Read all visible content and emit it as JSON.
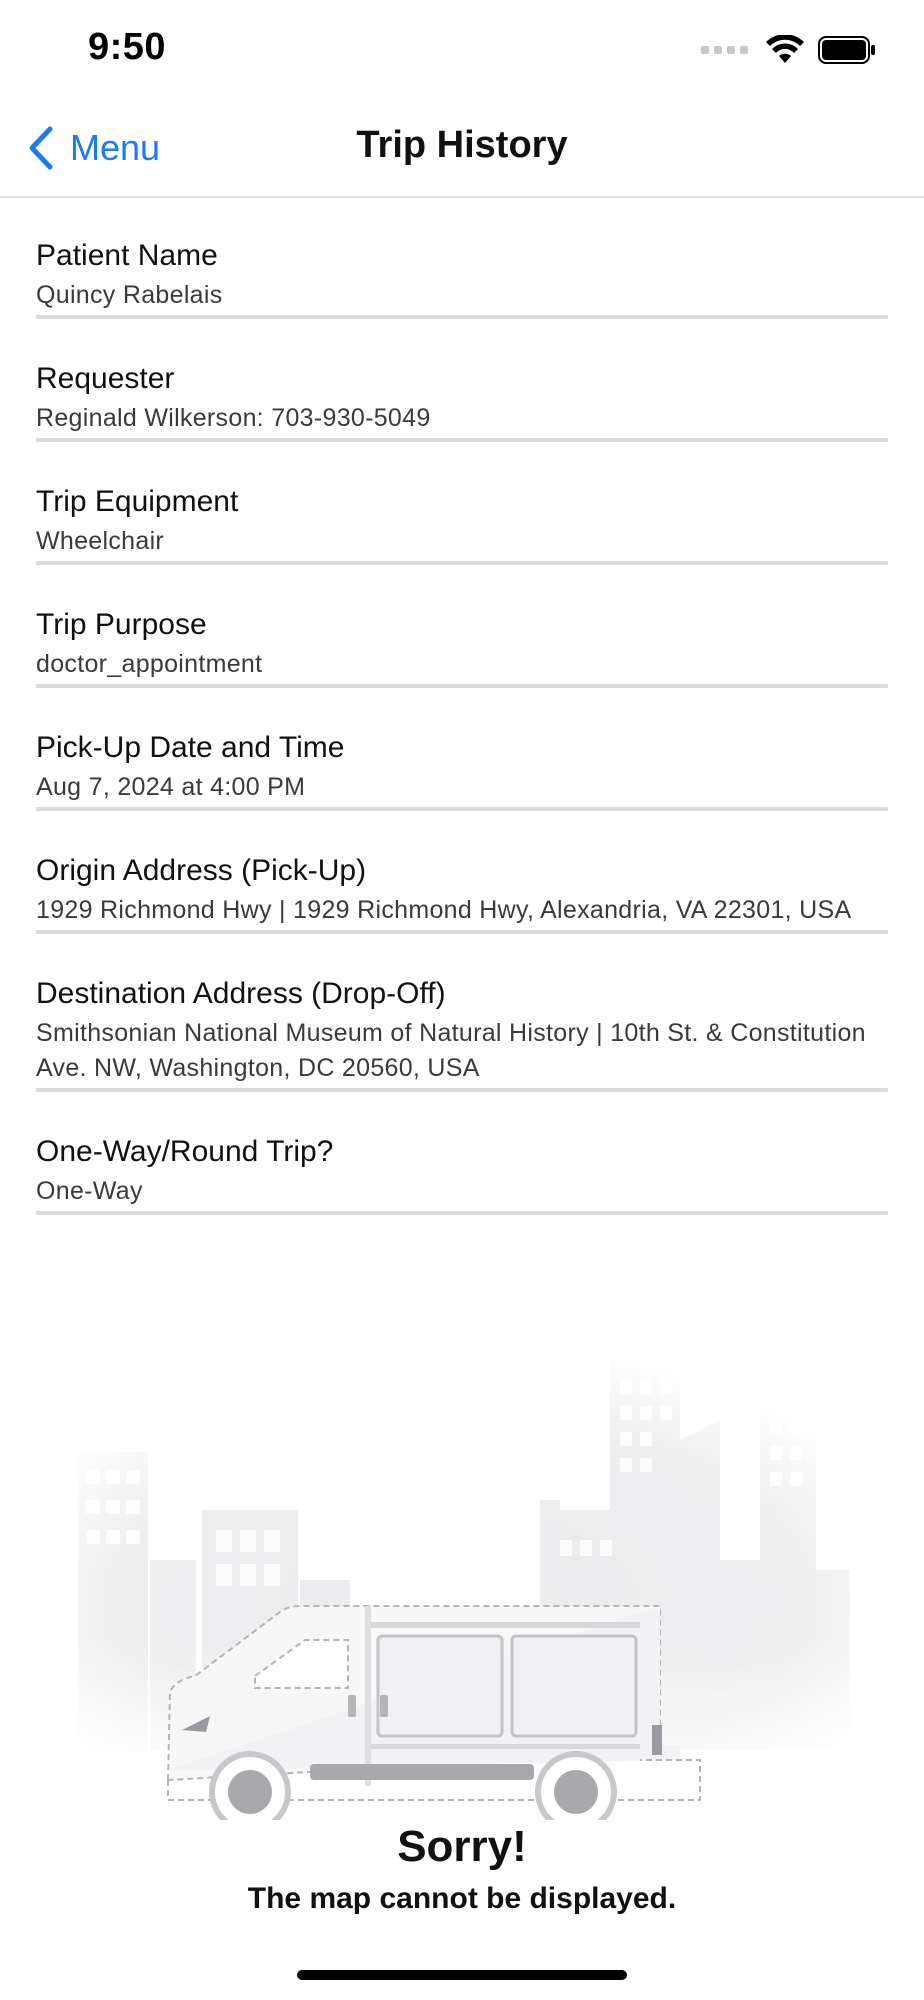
{
  "status_bar": {
    "time": "9:50"
  },
  "nav": {
    "back_label": "Menu",
    "title": "Trip History"
  },
  "fields": [
    {
      "label": "Patient Name",
      "value": "Quincy Rabelais"
    },
    {
      "label": "Requester",
      "value": "Reginald Wilkerson: 703-930-5049"
    },
    {
      "label": "Trip Equipment",
      "value": "Wheelchair"
    },
    {
      "label": "Trip Purpose",
      "value": "doctor_appointment"
    },
    {
      "label": "Pick-Up Date and Time",
      "value": "Aug 7, 2024 at 4:00 PM"
    },
    {
      "label": "Origin Address (Pick-Up)",
      "value": "1929 Richmond Hwy | 1929 Richmond Hwy, Alexandria, VA 22301, USA"
    },
    {
      "label": "Destination Address (Drop-Off)",
      "value": "Smithsonian National Museum of Natural History | 10th St. & Constitution Ave. NW, Washington, DC 20560, USA"
    },
    {
      "label": "One-Way/Round Trip?",
      "value": "One-Way"
    }
  ],
  "map_error": {
    "title": "Sorry!",
    "subtitle": "The map cannot be displayed."
  },
  "colors": {
    "accent": "#1a7cf5",
    "divider": "#dcdcdc",
    "value_text": "#3a3a3c"
  },
  "icons": {
    "back": "chevron-left-icon",
    "wifi": "wifi-icon",
    "battery": "battery-icon",
    "signal": "cellular-signal-icon",
    "illustration": "van-city-illustration"
  }
}
